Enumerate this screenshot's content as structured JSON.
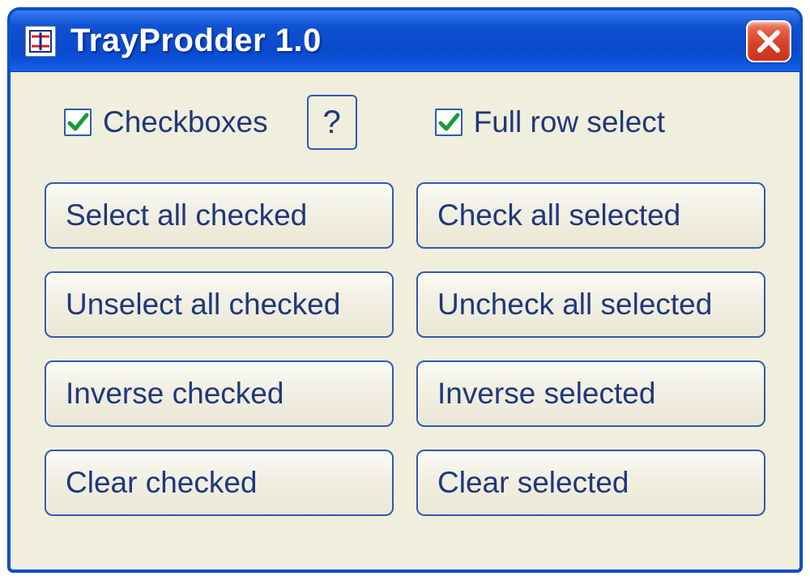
{
  "window": {
    "title": "TrayProdder 1.0"
  },
  "checkboxes": {
    "checkboxes_label": "Checkboxes",
    "checkboxes_checked": true,
    "full_row_label": "Full row select",
    "full_row_checked": true
  },
  "help_button": "?",
  "columns": {
    "left": [
      "Select all checked",
      "Unselect all checked",
      "Inverse checked",
      "Clear checked"
    ],
    "right": [
      "Check all selected",
      "Uncheck all selected",
      "Inverse selected",
      "Clear selected"
    ]
  },
  "colors": {
    "titlebar_blue": "#0a49cb",
    "close_red": "#d8412a",
    "client_bg": "#f0eedc",
    "text_navy": "#1f387b",
    "border_blue": "#2f5ab0",
    "check_green": "#1a9a3a"
  }
}
